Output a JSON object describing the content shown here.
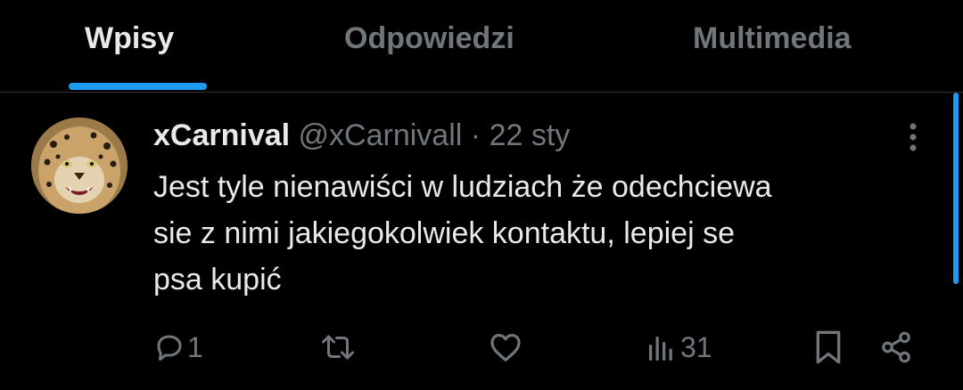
{
  "tabs": [
    {
      "label": "Wpisy",
      "active": true
    },
    {
      "label": "Odpowiedzi",
      "active": false
    },
    {
      "label": "Multimedia",
      "active": false
    }
  ],
  "post": {
    "display_name": "xCarnival",
    "handle": "@xCarnivall",
    "separator": "·",
    "date": "22 sty",
    "text_lines": [
      "Jest tyle nienawiści w ludziach że odechciewa",
      "sie z nimi jakiegokolwiek kontaktu, lepiej se",
      "psa kupić"
    ],
    "avatar_icon": "leopard-avatar",
    "actions": {
      "replies": "1",
      "reposts": "",
      "likes": "",
      "views": "31"
    }
  },
  "colors": {
    "background": "#000000",
    "text": "#e7e9ea",
    "muted": "#71767b",
    "accent": "#1d9bf0",
    "divider": "#2f3336"
  }
}
